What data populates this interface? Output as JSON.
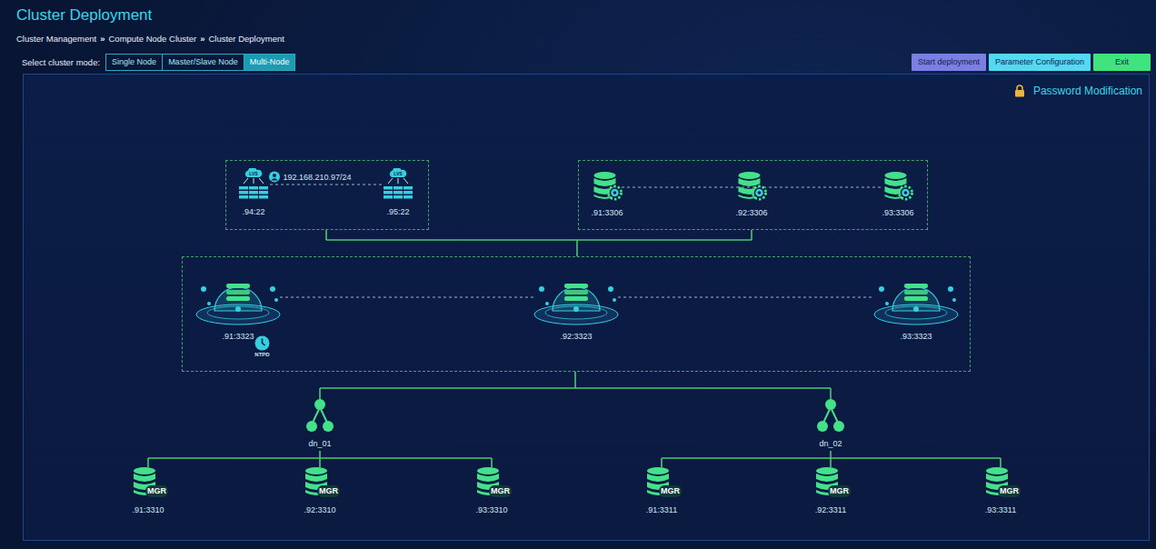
{
  "page": {
    "title": "Cluster Deployment"
  },
  "breadcrumb": {
    "separator": "»",
    "items": [
      "Cluster Management",
      "Compute Node Cluster",
      "Cluster Deployment"
    ]
  },
  "mode_selector": {
    "label": "Select cluster mode:",
    "options": [
      {
        "label": "Single Node",
        "selected": false
      },
      {
        "label": "Master/Slave Node",
        "selected": false
      },
      {
        "label": "Multi-Node",
        "selected": true
      }
    ]
  },
  "actions": [
    {
      "label": "Start deployment",
      "color": "#7b7fe3"
    },
    {
      "label": "Parameter Configuration",
      "color": "#52d9f3"
    },
    {
      "label": "Exit",
      "color": "#3ee57e"
    }
  ],
  "password_link": "Password Modification",
  "lvs_group": {
    "vip": "192.168.210.97/24",
    "nodes": [
      {
        "label": ".94:22",
        "badge": "LVS"
      },
      {
        "label": ".95:22",
        "badge": "LVS"
      }
    ]
  },
  "meta_group": {
    "nodes": [
      {
        "label": ".91:3306"
      },
      {
        "label": ".92:3306"
      },
      {
        "label": ".93:3306"
      }
    ]
  },
  "compute_group": {
    "ntpd_label": "NTPD",
    "nodes": [
      {
        "label": ".91:3323",
        "has_ntpd": true
      },
      {
        "label": ".92:3323",
        "has_ntpd": false
      },
      {
        "label": ".93:3323",
        "has_ntpd": false
      }
    ]
  },
  "data_nodes": [
    {
      "name": "dn_01",
      "replicas": [
        {
          "label": ".91:3310",
          "badge": "MGR"
        },
        {
          "label": ".92:3310",
          "badge": "MGR"
        },
        {
          "label": ".93:3310",
          "badge": "MGR"
        }
      ]
    },
    {
      "name": "dn_02",
      "replicas": [
        {
          "label": ".91:3311",
          "badge": "MGR"
        },
        {
          "label": ".92:3311",
          "badge": "MGR"
        },
        {
          "label": ".93:3311",
          "badge": "MGR"
        }
      ]
    }
  ]
}
